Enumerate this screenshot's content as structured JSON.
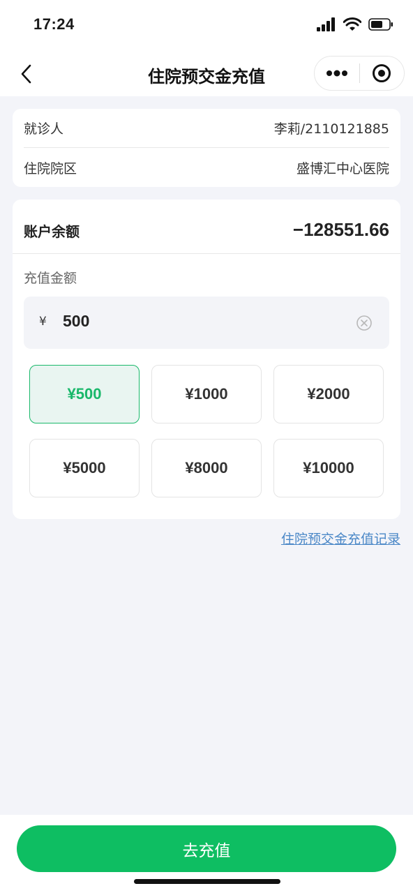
{
  "status_bar": {
    "time": "17:24"
  },
  "nav": {
    "title": "住院预交金充值"
  },
  "patient_info": {
    "rows": [
      {
        "label": "就诊人",
        "value": "李莉/2110121885"
      },
      {
        "label": "住院院区",
        "value": "盛博汇中心医院"
      }
    ]
  },
  "account": {
    "balance_label": "账户余额",
    "balance_value": "−128551.66",
    "amount_label": "充值金额",
    "currency_sign": "¥",
    "amount_value": "500"
  },
  "presets": [
    "¥500",
    "¥1000",
    "¥2000",
    "¥5000",
    "¥8000",
    "¥10000"
  ],
  "selected_preset": "¥500",
  "record_link": "住院预交金充值记录",
  "submit_label": "去充值",
  "colors": {
    "accent": "#0ebe62",
    "link": "#4a87c7",
    "background": "#f3f4f9"
  }
}
